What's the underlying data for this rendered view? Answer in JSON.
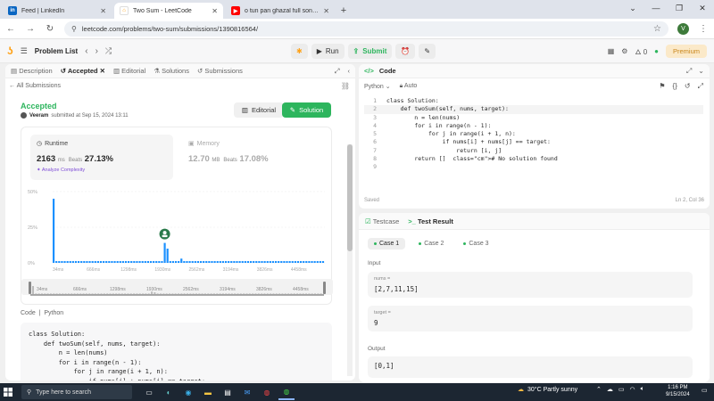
{
  "browser": {
    "tabs": [
      {
        "title": "Feed | LinkedIn",
        "favicon": "linkedin-icon",
        "color": "#0a66c2",
        "active": false
      },
      {
        "title": "Two Sum - LeetCode",
        "favicon": "leetcode-icon",
        "color": "#ffa116",
        "active": true
      },
      {
        "title": "o tun pan ghazal full song - You",
        "favicon": "youtube-icon",
        "color": "#ff0000",
        "active": false
      }
    ],
    "url": "leetcode.com/problems/two-sum/submissions/1390816564/",
    "profile_initial": "V"
  },
  "lc_toolbar": {
    "problem_list": "Problem List",
    "run": "Run",
    "submit": "Submit",
    "fire_count": "0",
    "premium": "Premium"
  },
  "left_tabs": [
    "Description",
    "Accepted",
    "Editorial",
    "Solutions",
    "Submissions"
  ],
  "submission": {
    "back": "All Submissions",
    "status": "Accepted",
    "author": "Veeram",
    "submitted": "submitted at Sep 15, 2024 13:11",
    "editorial_btn": "Editorial",
    "solution_btn": "Solution",
    "runtime_label": "Runtime",
    "runtime_value": "2163",
    "runtime_unit": "ms",
    "beats_label": "Beats",
    "runtime_beats": "27.13%",
    "analyze": "Analyze Complexity",
    "memory_label": "Memory",
    "memory_value": "12.70",
    "memory_unit": "MB",
    "memory_beats": "17.08%"
  },
  "chart_data": {
    "type": "bar",
    "y_ticks": [
      "50%",
      "25%",
      "0%"
    ],
    "ylim": [
      0,
      50
    ],
    "x_ticks": [
      "34ms",
      "666ms",
      "1298ms",
      "1930ms",
      "2562ms",
      "3194ms",
      "3826ms",
      "4458ms"
    ],
    "values": [
      45,
      1,
      1,
      1,
      1,
      1,
      1,
      1,
      1,
      1,
      1,
      1,
      1,
      1,
      1,
      1,
      1,
      1,
      1,
      1,
      1,
      1,
      1,
      1,
      1,
      1,
      1,
      1,
      1,
      1,
      1,
      1,
      1,
      1,
      1,
      1,
      1,
      1,
      1,
      1,
      14,
      10,
      1,
      1,
      1,
      1,
      3,
      1,
      1,
      1,
      1,
      1,
      1,
      1,
      1,
      1,
      1,
      1,
      1,
      1,
      1,
      1,
      1,
      1,
      1,
      1,
      1,
      1,
      1,
      1,
      1,
      1,
      1,
      1,
      1,
      1,
      1,
      1,
      1,
      1,
      1,
      1,
      1,
      1,
      1,
      1,
      1,
      1,
      1,
      1,
      1,
      1,
      1,
      1,
      1,
      1,
      1,
      1
    ],
    "highlight_index": 40,
    "bar_color": "#1a90ff"
  },
  "code_section": {
    "label": "Code",
    "lang": "Python",
    "lines": [
      "class Solution:",
      "    def twoSum(self, nums, target):",
      "        n = len(nums)",
      "        for i in range(n - 1):",
      "            for j in range(i + 1, n):",
      "                if nums[i] + nums[j] == target:"
    ]
  },
  "editor": {
    "title": "Code",
    "language": "Python",
    "auto": "Auto",
    "lines": [
      "class Solution:",
      "    def twoSum(self, nums, target):",
      "        n = len(nums)",
      "        for i in range(n - 1):",
      "            for j in range(i + 1, n):",
      "                if nums[i] + nums[j] == target:",
      "                    return [i, j]",
      "        return []  # No solution found",
      ""
    ],
    "saved": "Saved",
    "position": "Ln 2, Col 36"
  },
  "testpanel": {
    "tab_testcase": "Testcase",
    "tab_result": "Test Result",
    "cases": [
      "Case 1",
      "Case 2",
      "Case 3"
    ],
    "input_label": "Input",
    "nums_label": "nums =",
    "nums_value": "[2,7,11,15]",
    "target_label": "target =",
    "target_value": "9",
    "output_label": "Output",
    "output_value": "[0,1]"
  },
  "taskbar": {
    "search": "Type here to search",
    "weather": "30°C  Partly sunny",
    "time": "1:16 PM",
    "date": "9/15/2024"
  }
}
